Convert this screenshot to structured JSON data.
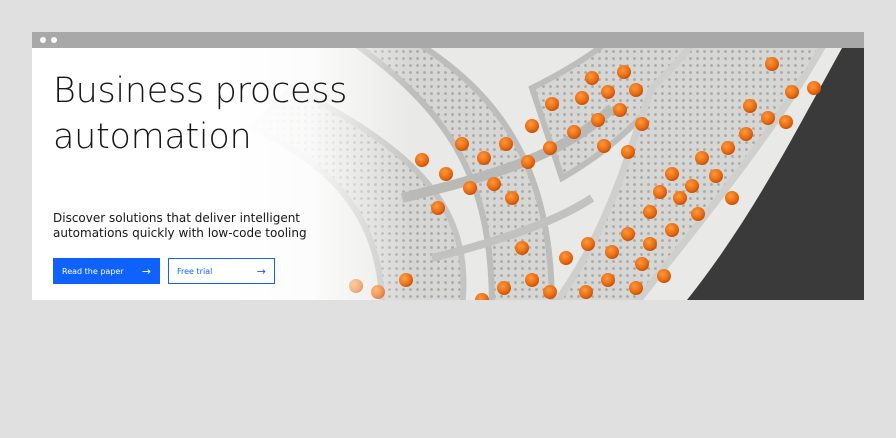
{
  "hero": {
    "headline": "Business process automation",
    "description": "Discover solutions that deliver intelligent automations quickly with low-code tooling",
    "primary_button": {
      "label": "Read the paper",
      "icon": "arrow-right-icon"
    },
    "secondary_button": {
      "label": "Free trial",
      "icon": "arrow-right-icon"
    },
    "image_subject": "oranges on conveyor belts"
  },
  "colors": {
    "accent": "#0f62fe",
    "text": "#161616",
    "page_background": "#e0e0e0",
    "titlebar": "#a8a8a8"
  }
}
